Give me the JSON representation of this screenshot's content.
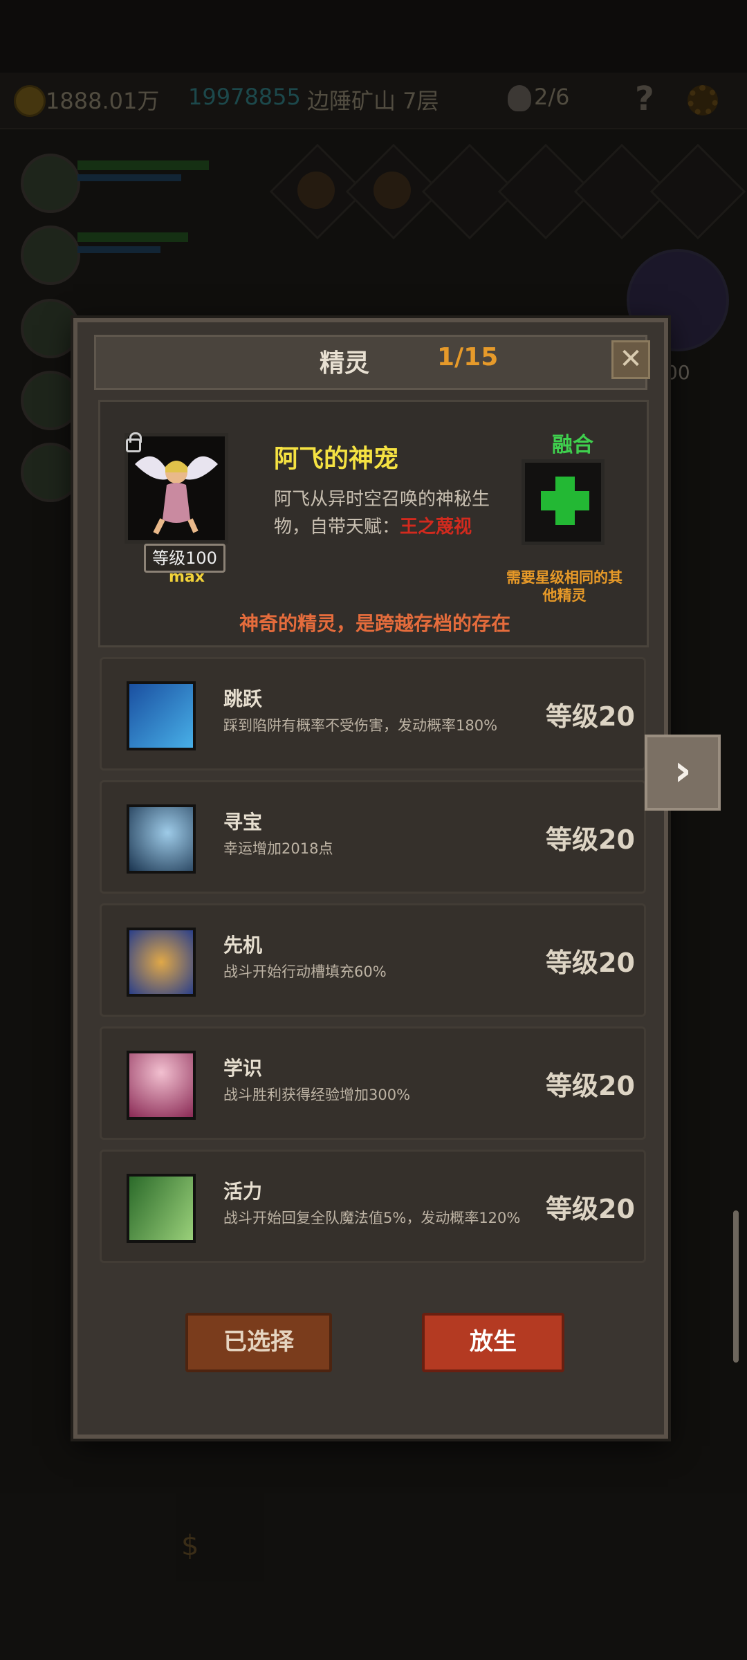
{
  "hud": {
    "gold": "1888.01万",
    "diamonds": "19978855",
    "location": "边陲矿山 7层",
    "kills": "2/6",
    "help": "?"
  },
  "bg": {
    "pet_level_tail": "00"
  },
  "modal": {
    "title": "精灵",
    "count": "1/15",
    "close": "✕"
  },
  "pet": {
    "level": "等级100",
    "max": "max",
    "name": "阿飞的神宠",
    "desc_prefix": "阿飞从异时空召唤的神秘生物，自带天赋：",
    "talent": "王之蔑视",
    "tagline": "神奇的精灵，是跨越存档的存在"
  },
  "fuse": {
    "label": "融合",
    "note": "需要星级相同的其他精灵"
  },
  "skills": [
    {
      "name": "跳跃",
      "desc": "踩到陷阱有概率不受伤害，发动概率180%",
      "level": "等级20",
      "icon": "leap-skill-icon",
      "color": "#2a7fc9"
    },
    {
      "name": "寻宝",
      "desc": "幸运增加2018点",
      "level": "等级20",
      "icon": "treasure-skill-icon",
      "color": "#8fb8d8"
    },
    {
      "name": "先机",
      "desc": "战斗开始行动槽填充60%",
      "level": "等级20",
      "icon": "leopard-skill-icon",
      "color": "#c98a2e"
    },
    {
      "name": "学识",
      "desc": "战斗胜利获得经验增加300%",
      "level": "等级20",
      "icon": "wisdom-skill-icon",
      "color": "#c04a78"
    },
    {
      "name": "活力",
      "desc": "战斗开始回复全队魔法值5%，发动概率120%",
      "level": "等级20",
      "icon": "vitality-skill-icon",
      "color": "#3f8a3a"
    }
  ],
  "buttons": {
    "selected": "已选择",
    "release": "放生"
  },
  "nav": {
    "next": "›"
  },
  "misc": {
    "dim_glyph": "$"
  }
}
